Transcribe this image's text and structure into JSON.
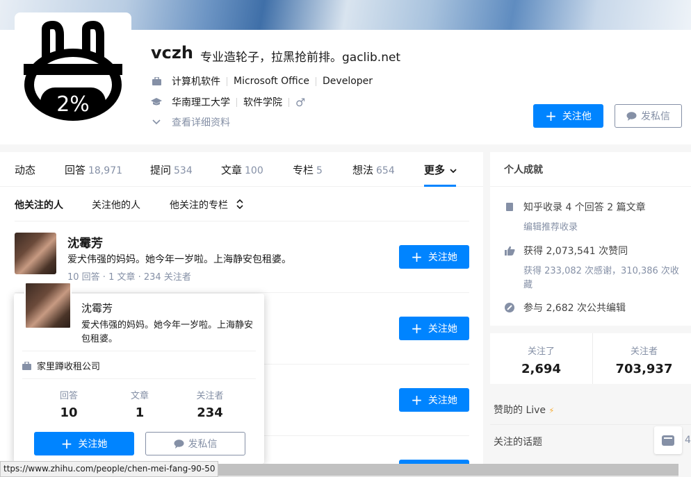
{
  "profile": {
    "name": "vczh",
    "headline": "专业造轮子，拉黑抢前排。gaclib.net",
    "avatar_text": "2%",
    "work": [
      "计算机软件",
      "Microsoft Office",
      "Developer"
    ],
    "education": [
      "华南理工大学",
      "软件学院"
    ],
    "view_details": "查看详细资料",
    "follow_label": "关注他",
    "message_label": "发私信"
  },
  "tabs": [
    {
      "label": "动态",
      "count": ""
    },
    {
      "label": "回答",
      "count": "18,971"
    },
    {
      "label": "提问",
      "count": "534"
    },
    {
      "label": "文章",
      "count": "100"
    },
    {
      "label": "专栏",
      "count": "5"
    },
    {
      "label": "想法",
      "count": "654"
    },
    {
      "label": "更多",
      "count": ""
    }
  ],
  "subtabs": [
    "他关注的人",
    "关注他的人",
    "他关注的专栏"
  ],
  "list": {
    "first_user": {
      "name": "沈霉芳",
      "bio": "爱犬伟强的妈妈。她今年一岁啦。上海静安包租婆。",
      "meta": "10 回答 · 1 文章 · 234 关注者"
    },
    "follow_her_label": "关注她"
  },
  "popover": {
    "name": "沈霉芳",
    "bio": "爱犬伟强的妈妈。她今年一岁啦。上海静安包租婆。",
    "company": "家里蹲收租公司",
    "stats": [
      {
        "label": "回答",
        "value": "10"
      },
      {
        "label": "文章",
        "value": "1"
      },
      {
        "label": "关注者",
        "value": "234"
      }
    ],
    "follow_label": "关注她",
    "message_label": "发私信"
  },
  "sidebar": {
    "achievements_title": "个人成就",
    "collected": "知乎收录 4 个回答 2 篇文章",
    "edit_recommend": "编辑推荐收录",
    "upvotes": "获得 2,073,541 次赞同",
    "thanks": "获得 233,082 次感谢，310,386 次收藏",
    "edits": "参与 2,682 次公共编辑",
    "following_label": "关注了",
    "following_count": "2,694",
    "followers_label": "关注者",
    "followers_count": "703,937",
    "sponsored_live": "赞助的 Live",
    "followed_topics": "关注的话题",
    "topics_partial": "4"
  },
  "statusbar": {
    "url": "ttps://www.zhihu.com/people/chen-mei-fang-90-50"
  },
  "colors": {
    "accent": "#0084ff",
    "muted": "#8590a6"
  }
}
